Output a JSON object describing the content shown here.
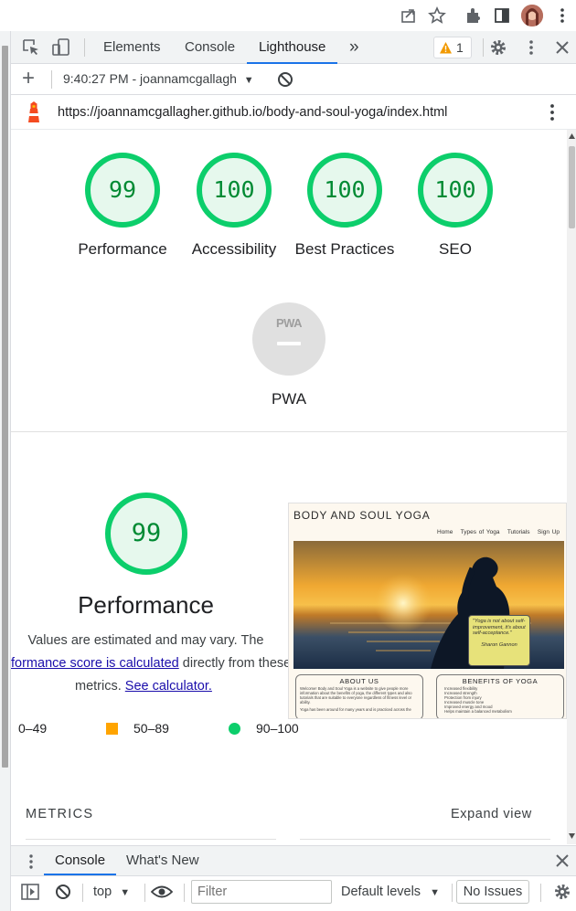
{
  "browser": {
    "icons": [
      "share-icon",
      "star-icon",
      "extensions-icon",
      "sidepanel-icon",
      "profile-avatar",
      "more-icon"
    ]
  },
  "devtools": {
    "tabs": [
      "Elements",
      "Console",
      "Lighthouse"
    ],
    "active_tab": "Lighthouse",
    "more_tabs_glyph": "»",
    "issues_badge": "1"
  },
  "report_toolbar": {
    "add_glyph": "+",
    "report_selector": "9:40:27 PM - joannamcgallagh"
  },
  "url": "https://joannamcgallagher.github.io/body-and-soul-yoga/index.html",
  "scores": [
    {
      "label": "Performance",
      "value": "99"
    },
    {
      "label": "Accessibility",
      "value": "100"
    },
    {
      "label": "Best Practices",
      "value": "100"
    },
    {
      "label": "SEO",
      "value": "100"
    }
  ],
  "pwa": {
    "badge": "PWA",
    "label": "PWA"
  },
  "performance": {
    "score": "99",
    "title": "Performance",
    "desc_line1": "Values are estimated and may vary. The",
    "desc_link1": "formance score is calculated",
    "desc_mid": " directly from these",
    "desc_line3_pre": "metrics.",
    "desc_link2": "See calculator."
  },
  "legend": [
    {
      "range": "0–49",
      "color": "#ff4e42",
      "shape": "triangle"
    },
    {
      "range": "50–89",
      "color": "#ffa400",
      "shape": "square"
    },
    {
      "range": "90–100",
      "color": "#0cce6b",
      "shape": "circle"
    }
  ],
  "metrics": {
    "heading": "METRICS",
    "expand": "Expand view"
  },
  "screenshot": {
    "site_title": "BODY AND SOUL YOGA",
    "nav": [
      "Home",
      "Types of Yoga",
      "Tutorials",
      "Sign Up"
    ],
    "quote": "\"Yoga is not about self-improvement, it's about self-acceptance.\"",
    "quote_author": "Sharon Gannon",
    "about_heading": "ABOUT US",
    "about_text": "Welcome! Body and Soul Yoga is a website to give people more information about the benefits of yoga, the different types and also tutorials that are suitable to everyone regardless of fitness level or ability.",
    "about_text2": "Yoga has been around for many years and is practiced across the",
    "benefits_heading": "BENEFITS OF YOGA",
    "benefits": [
      "Increased flexibility",
      "Increased strength",
      "Protection from injury",
      "Increased muscle tone",
      "Improved energy and mood",
      "Helps maintain a balanced metabolism"
    ]
  },
  "drawer": {
    "tabs": [
      "Console",
      "What's New"
    ],
    "context": "top",
    "filter_placeholder": "Filter",
    "levels": "Default levels",
    "issues": "No Issues"
  }
}
